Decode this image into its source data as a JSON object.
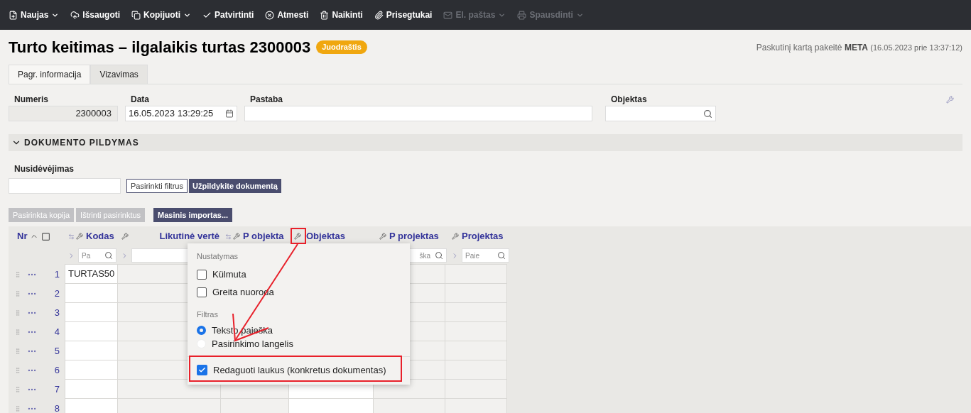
{
  "toolbar": [
    {
      "label": "Naujas",
      "dropdown": true,
      "disabled": false
    },
    {
      "label": "Išsaugoti",
      "dropdown": false,
      "disabled": false
    },
    {
      "label": "Kopijuoti",
      "dropdown": true,
      "disabled": false
    },
    {
      "label": "Patvirtinti",
      "dropdown": false,
      "disabled": false
    },
    {
      "label": "Atmesti",
      "dropdown": false,
      "disabled": false
    },
    {
      "label": "Naikinti",
      "dropdown": false,
      "disabled": false
    },
    {
      "label": "Prisegtukai",
      "dropdown": false,
      "disabled": false
    },
    {
      "label": "El. paštas",
      "dropdown": true,
      "disabled": true
    },
    {
      "label": "Spausdinti",
      "dropdown": true,
      "disabled": true
    }
  ],
  "title": "Turto keitimas – ilgalaikis turtas 2300003",
  "status_badge": "Juodraštis",
  "last_modified": {
    "prefix": "Paskutinį kartą pakeitė",
    "user": "META",
    "date": "(16.05.2023 prie 13:37:12)"
  },
  "tabs": [
    {
      "label": "Pagr. informacija",
      "selected": true
    },
    {
      "label": "Vizavimas",
      "selected": false
    }
  ],
  "fields": {
    "numeris": {
      "label": "Numeris",
      "value": "2300003"
    },
    "data": {
      "label": "Data",
      "value": "16.05.2023 13:29:25"
    },
    "pastaba": {
      "label": "Pastaba"
    },
    "objektas": {
      "label": "Objektas"
    }
  },
  "section": {
    "title": "DOKUMENTO PILDYMAS",
    "expanded": true
  },
  "nusidevejimas": {
    "label": "Nusidėvėjimas"
  },
  "fill_buttons": [
    {
      "label": "Pasirinkti filtrus",
      "kind": "outline"
    },
    {
      "label": "Užpildykite dokumentą",
      "kind": "primary"
    }
  ],
  "grid_buttons": [
    {
      "label": "Pasirinkta kopija",
      "disabled": true
    },
    {
      "label": "Ištrinti pasirinktus",
      "disabled": true
    },
    {
      "label": "Masinis importas...",
      "disabled": false
    }
  ],
  "table": {
    "nr_label": "Nr",
    "select_all": {
      "checked": false
    },
    "columns": [
      {
        "label": "Kodas",
        "pinned": true,
        "editable": true,
        "filter_placeholder": "Pa"
      },
      {
        "label": "Likutinė vertė",
        "pinned": false,
        "editable": false
      },
      {
        "label": "P objekta",
        "pinned": true,
        "editable": false
      },
      {
        "label": "Objektas",
        "pinned": false,
        "editable": true,
        "highlighted": true
      },
      {
        "label": "P projektas",
        "pinned": false,
        "editable": false,
        "filter_placeholder": "ška"
      },
      {
        "label": "Projektas",
        "pinned": false,
        "editable": false,
        "filter_placeholder": "Paie"
      }
    ],
    "rows": [
      {
        "nr": "1",
        "cells": [
          "TURTAS50"
        ]
      },
      {
        "nr": "2"
      },
      {
        "nr": "3"
      },
      {
        "nr": "4"
      },
      {
        "nr": "5"
      },
      {
        "nr": "6"
      },
      {
        "nr": "7"
      },
      {
        "nr": "8"
      }
    ]
  },
  "popup": {
    "sections": [
      {
        "title": "Nustatymas",
        "options": [
          {
            "label": "Külmuta",
            "kind": "checkbox",
            "checked": false
          },
          {
            "label": "Greita nuoroda",
            "kind": "checkbox",
            "checked": false
          }
        ]
      },
      {
        "title": "Filtras",
        "options": [
          {
            "label": "Teksto paieška",
            "kind": "radio",
            "checked": true
          },
          {
            "label": "Pasirinkimo langelis",
            "kind": "radio",
            "checked": false
          }
        ]
      },
      {
        "options": [
          {
            "label": "Redaguoti laukus (konkretus dokumentas)",
            "kind": "checkbox",
            "checked": true,
            "highlighted": true
          }
        ]
      }
    ]
  }
}
